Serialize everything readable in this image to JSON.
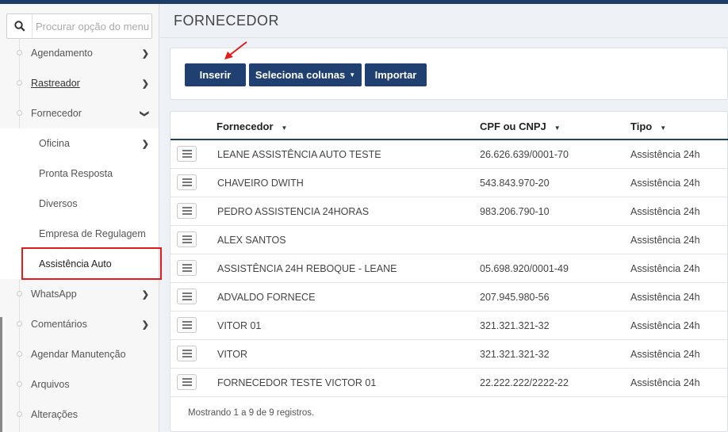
{
  "search": {
    "placeholder": "Procurar opção do menu"
  },
  "sidebar": {
    "items": [
      {
        "label": "Agendamento",
        "chevron": ">"
      },
      {
        "label": "Rastreador",
        "chevron": ">"
      },
      {
        "label": "Fornecedor",
        "chevron": "v"
      },
      {
        "label": "Oficina",
        "chevron": ">"
      },
      {
        "label": "Pronta Resposta"
      },
      {
        "label": "Diversos"
      },
      {
        "label": "Empresa de Regulagem"
      },
      {
        "label": "Assistência Auto"
      },
      {
        "label": "WhatsApp",
        "chevron": ">"
      },
      {
        "label": "Comentários",
        "chevron": ">"
      },
      {
        "label": "Agendar Manutenção"
      },
      {
        "label": "Arquivos"
      },
      {
        "label": "Alterações"
      }
    ]
  },
  "page": {
    "title": "FORNECEDOR"
  },
  "toolbar": {
    "insert_label": "Inserir",
    "columns_label": "Seleciona colunas",
    "import_label": "Importar"
  },
  "table": {
    "headers": [
      "Fornecedor",
      "CPF ou CNPJ",
      "Tipo"
    ],
    "rows": [
      [
        "LEANE ASSISTÊNCIA AUTO TESTE",
        "26.626.639/0001-70",
        "Assistência 24h"
      ],
      [
        "CHAVEIRO DWITH",
        "543.843.970-20",
        "Assistência 24h"
      ],
      [
        "PEDRO ASSISTENCIA 24HORAS",
        "983.206.790-10",
        "Assistência 24h"
      ],
      [
        "ALEX SANTOS",
        "",
        "Assistência 24h"
      ],
      [
        "ASSISTÊNCIA 24H REBOQUE - LEANE",
        "05.698.920/0001-49",
        "Assistência 24h"
      ],
      [
        "ADVALDO FORNECE",
        "207.945.980-56",
        "Assistência 24h"
      ],
      [
        "VITOR 01",
        "321.321.321-32",
        "Assistência 24h"
      ],
      [
        "VITOR",
        "321.321.321-32",
        "Assistência 24h"
      ],
      [
        "FORNECEDOR TESTE VICTOR 01",
        "22.222.222/2222-22",
        "Assistência 24h"
      ]
    ],
    "footer": "Mostrando 1 a 9 de 9 registros."
  },
  "colors": {
    "primary": "#1f4071",
    "highlight": "#e31b1b"
  }
}
